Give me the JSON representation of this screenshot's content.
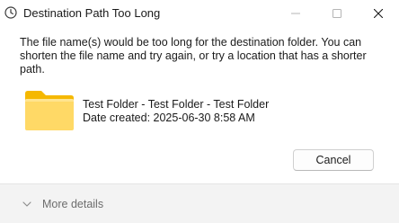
{
  "window": {
    "title": "Destination Path Too Long",
    "controls": {
      "minimize_icon": "minimize-icon",
      "maximize_icon": "maximize-icon",
      "close_icon": "close-icon"
    }
  },
  "dialog": {
    "message": "The file name(s) would be too long for the destination folder. You can shorten the file name and try again, or try a location that has a shorter path.",
    "file": {
      "icon": "folder-icon",
      "name": "Test Folder - Test Folder - Test Folder",
      "date_created": "Date created: 2025-06-30 8:58 AM"
    },
    "cancel_label": "Cancel"
  },
  "footer": {
    "more_details_label": "More details",
    "chevron_icon": "chevron-down-icon"
  },
  "colors": {
    "folder_light": "#FFD966",
    "folder_dark": "#F5B800",
    "footer_bg": "#F3F3F3",
    "muted_text": "#6D6D6D"
  }
}
